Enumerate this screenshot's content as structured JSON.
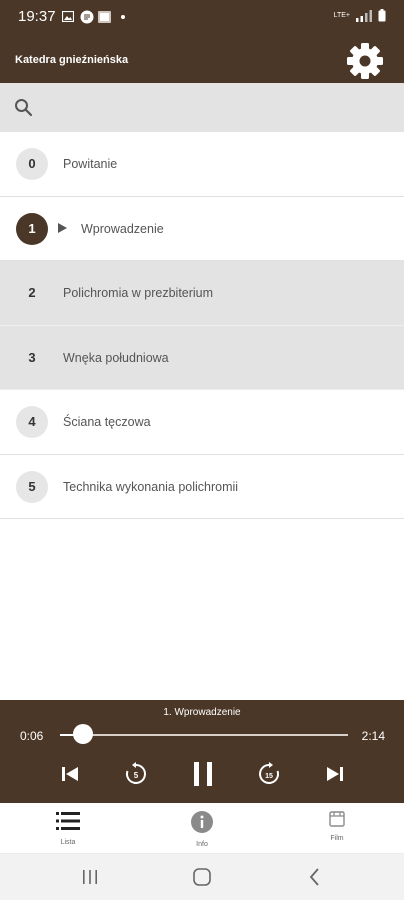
{
  "status_bar": {
    "time": "19:37",
    "network_label": "LTE+",
    "icons": [
      "image-icon",
      "chat-icon",
      "gallery-icon",
      "notification-dot-icon",
      "signal-icon",
      "battery-icon"
    ]
  },
  "app_bar": {
    "title": "Katedra gnieźnieńska",
    "settings_icon": "gear-icon"
  },
  "search": {
    "placeholder": "",
    "value": ""
  },
  "list": {
    "items": [
      {
        "number": "0",
        "label": "Powitanie"
      },
      {
        "number": "1",
        "label": "Wprowadzenie",
        "active": true
      },
      {
        "number": "2",
        "label": "Polichromia w prezbiterium"
      },
      {
        "number": "3",
        "label": "Wnęka południowa"
      },
      {
        "number": "4",
        "label": "Ściana tęczowa"
      },
      {
        "number": "5",
        "label": "Technika wykonania polichromii"
      }
    ]
  },
  "player": {
    "track_title": "1. Wprowadzenie",
    "current_time": "0:06",
    "total_time": "2:14",
    "progress": 0.045,
    "rewind_seconds": "5",
    "forward_seconds": "15",
    "controls": [
      "skip-previous-icon",
      "rewind-5-icon",
      "pause-icon",
      "forward-15-icon",
      "skip-next-icon"
    ]
  },
  "bottom_nav": {
    "items": [
      {
        "label": "Lista",
        "icon": "list-icon"
      },
      {
        "label": "Info",
        "icon": "info-icon"
      },
      {
        "label": "Film",
        "icon": "film-icon"
      }
    ]
  },
  "colors": {
    "brand": "#4a3727",
    "row_shaded": "#e3e3e3",
    "number_badge": "#e6e6e6"
  }
}
